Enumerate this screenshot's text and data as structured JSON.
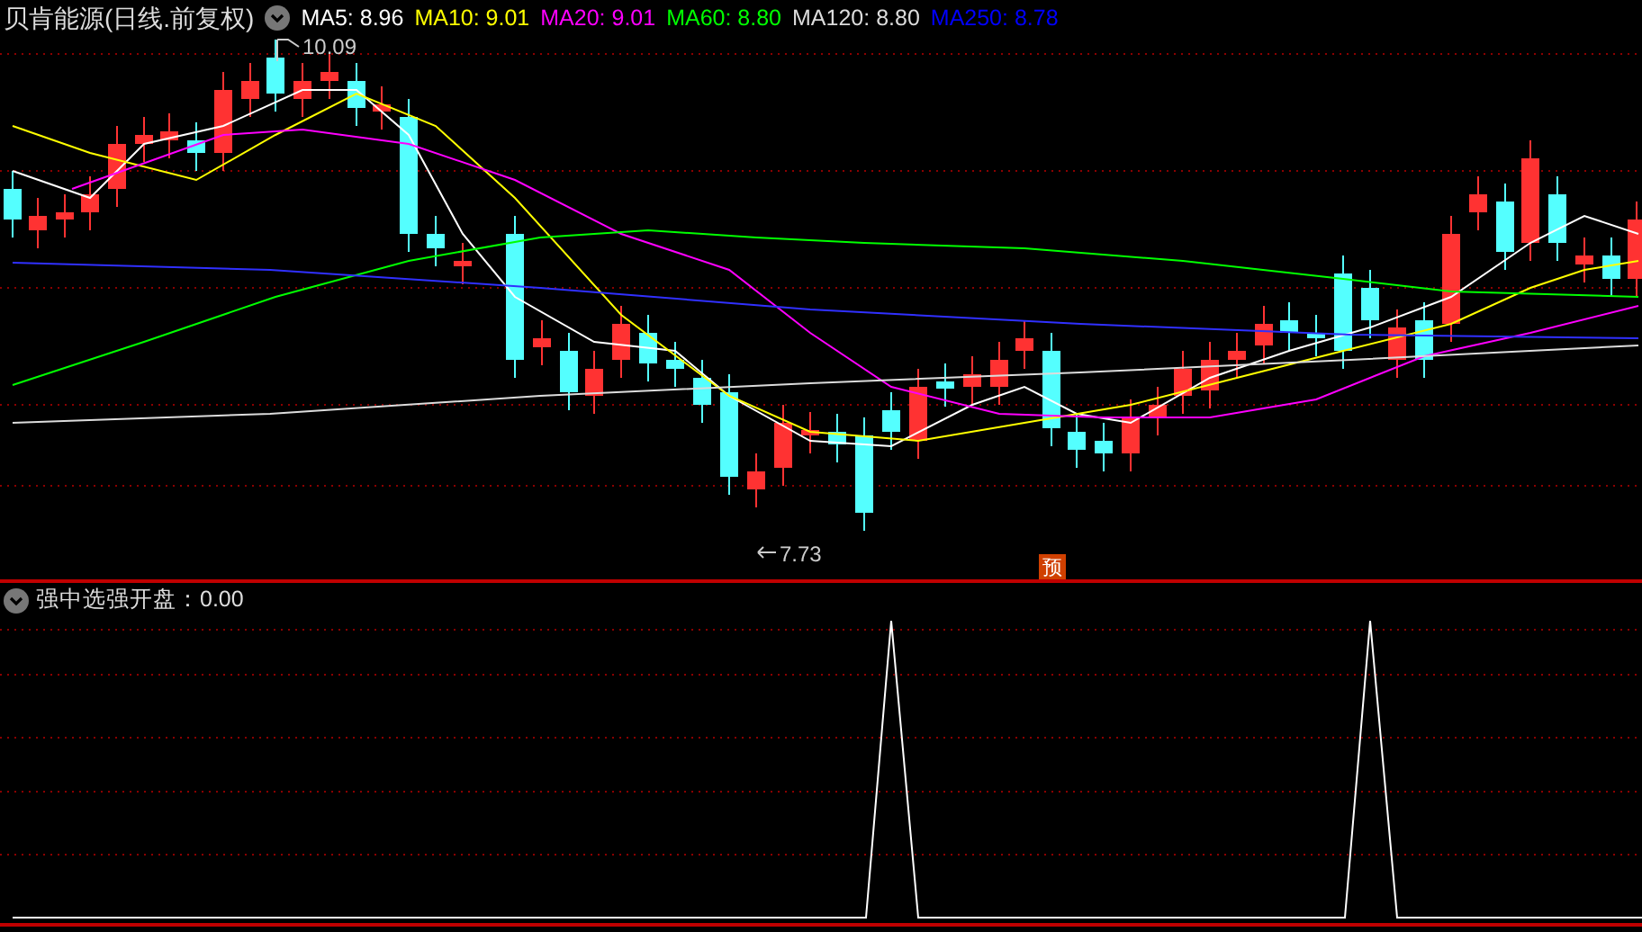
{
  "stock_header": {
    "title": "贝肯能源(日线.前复权)",
    "indicators": [
      {
        "label": "MA5: 8.96",
        "color": "#ffffff"
      },
      {
        "label": "MA10: 9.01",
        "color": "#ffff00"
      },
      {
        "label": "MA20: 9.01",
        "color": "#ff00ff"
      },
      {
        "label": "MA60: 8.80",
        "color": "#00ff00"
      },
      {
        "label": "MA120: 8.80",
        "color": "#dcdcdc"
      },
      {
        "label": "MA250: 8.78",
        "color": "#0000ff"
      }
    ]
  },
  "price_chart": {
    "high_label": "10.09",
    "low_label": "7.73",
    "badge": "预"
  },
  "indicator_panel": {
    "title": "强中选强开盘：0.00"
  }
}
